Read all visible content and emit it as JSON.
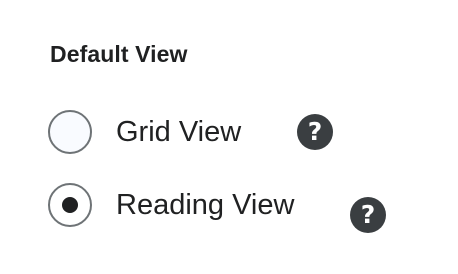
{
  "default_view": {
    "heading": "Default View",
    "options": [
      {
        "label": "Grid View",
        "selected": false,
        "help_icon": "question-circle-icon"
      },
      {
        "label": "Reading View",
        "selected": true,
        "help_icon": "question-circle-icon"
      }
    ],
    "help_glyph": "?"
  },
  "colors": {
    "text": "#202122",
    "radio_border": "#6e7376",
    "help_icon_bg": "#3a3e41"
  }
}
